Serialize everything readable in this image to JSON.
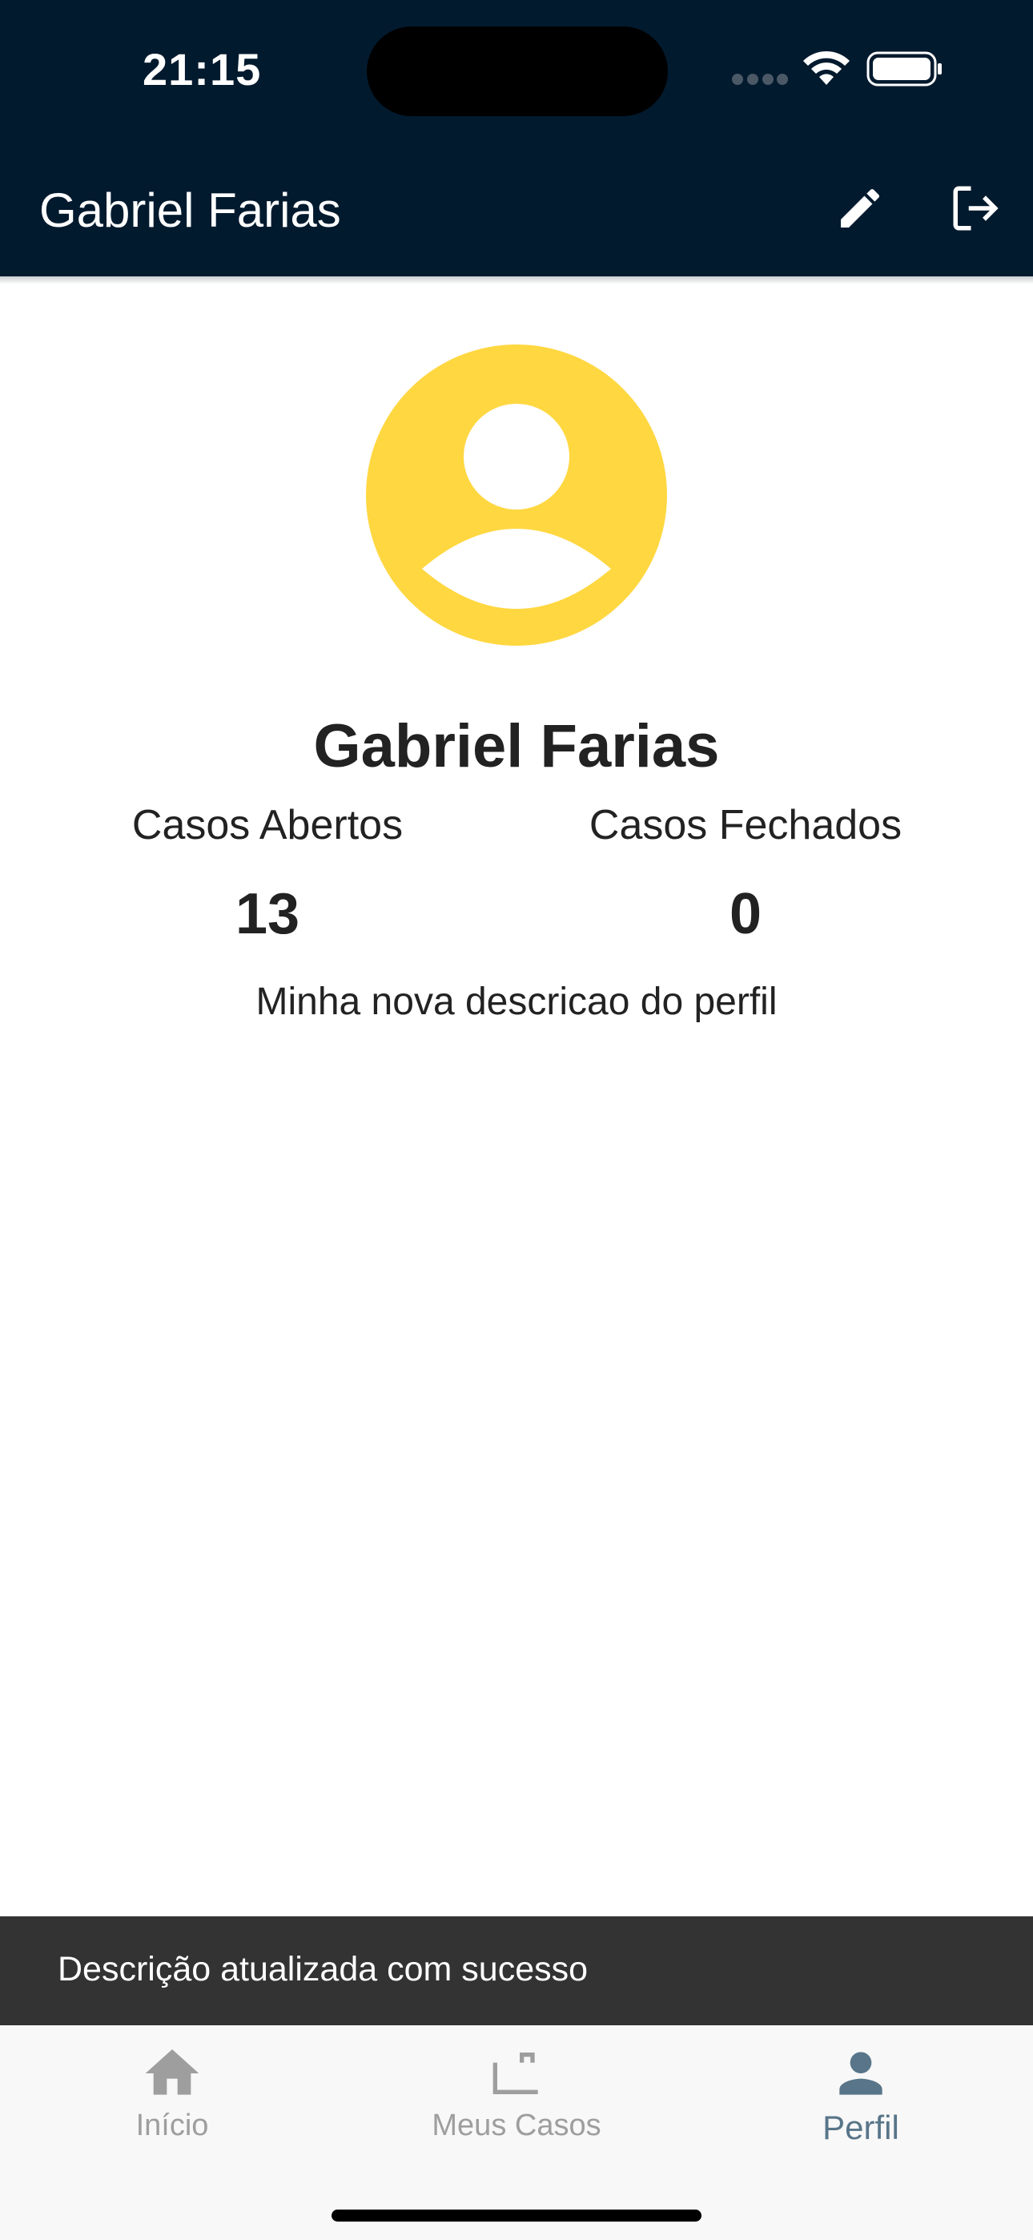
{
  "status_bar": {
    "time": "21:15"
  },
  "app_bar": {
    "title": "Gabriel Farias",
    "icons": [
      "pencil-icon",
      "logout-icon"
    ]
  },
  "profile": {
    "name": "Gabriel Farias",
    "avatar_color": "#ffd740",
    "stats": {
      "open_label": "Casos Abertos",
      "open_value": "13",
      "closed_label": "Casos Fechados",
      "closed_value": "0"
    },
    "description": "Minha nova descricao do perfil"
  },
  "snackbar": {
    "message": "Descrição atualizada com sucesso"
  },
  "bottom_nav": {
    "items": [
      {
        "label": "Início",
        "icon": "home-icon",
        "active": false
      },
      {
        "label": "Meus Casos",
        "icon": "briefcase-icon",
        "active": false
      },
      {
        "label": "Perfil",
        "icon": "person-icon",
        "active": true
      }
    ]
  },
  "colors": {
    "app_bar": "#021a2e",
    "active_nav": "#587589",
    "inactive_nav": "#9e9e9e",
    "snackbar": "#333333"
  }
}
